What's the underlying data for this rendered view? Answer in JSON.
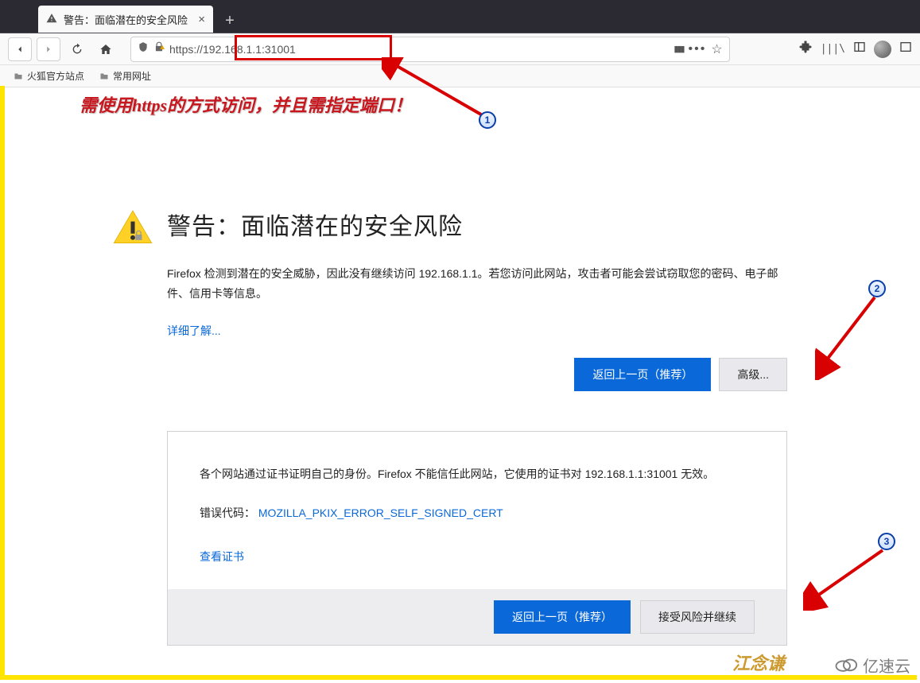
{
  "tab": {
    "title": "警告：面临潜在的安全风险"
  },
  "nav": {
    "url": "https://192.168.1.1:31001",
    "bookmarks": [
      "火狐官方站点",
      "常用网址"
    ]
  },
  "annotation": {
    "hint": "需使用https的方式访问，并且需指定端口！",
    "callouts": [
      "1",
      "2",
      "3"
    ]
  },
  "warning": {
    "title": "警告：面临潜在的安全风险",
    "body": "Firefox 检测到潜在的安全威胁，因此没有继续访问 192.168.1.1。若您访问此网站，攻击者可能会尝试窃取您的密码、电子邮件、信用卡等信息。",
    "learn_more": "详细了解...",
    "go_back": "返回上一页（推荐）",
    "advanced": "高级..."
  },
  "details": {
    "explain": "各个网站通过证书证明自己的身份。Firefox 不能信任此网站，它使用的证书对 192.168.1.1:31001 无效。",
    "error_label": "错误代码：",
    "error_code": "MOZILLA_PKIX_ERROR_SELF_SIGNED_CERT",
    "view_cert": "查看证书",
    "go_back": "返回上一页（推荐）",
    "accept": "接受风险并继续"
  },
  "watermark": {
    "name": "江念谦",
    "brand": "亿速云"
  }
}
